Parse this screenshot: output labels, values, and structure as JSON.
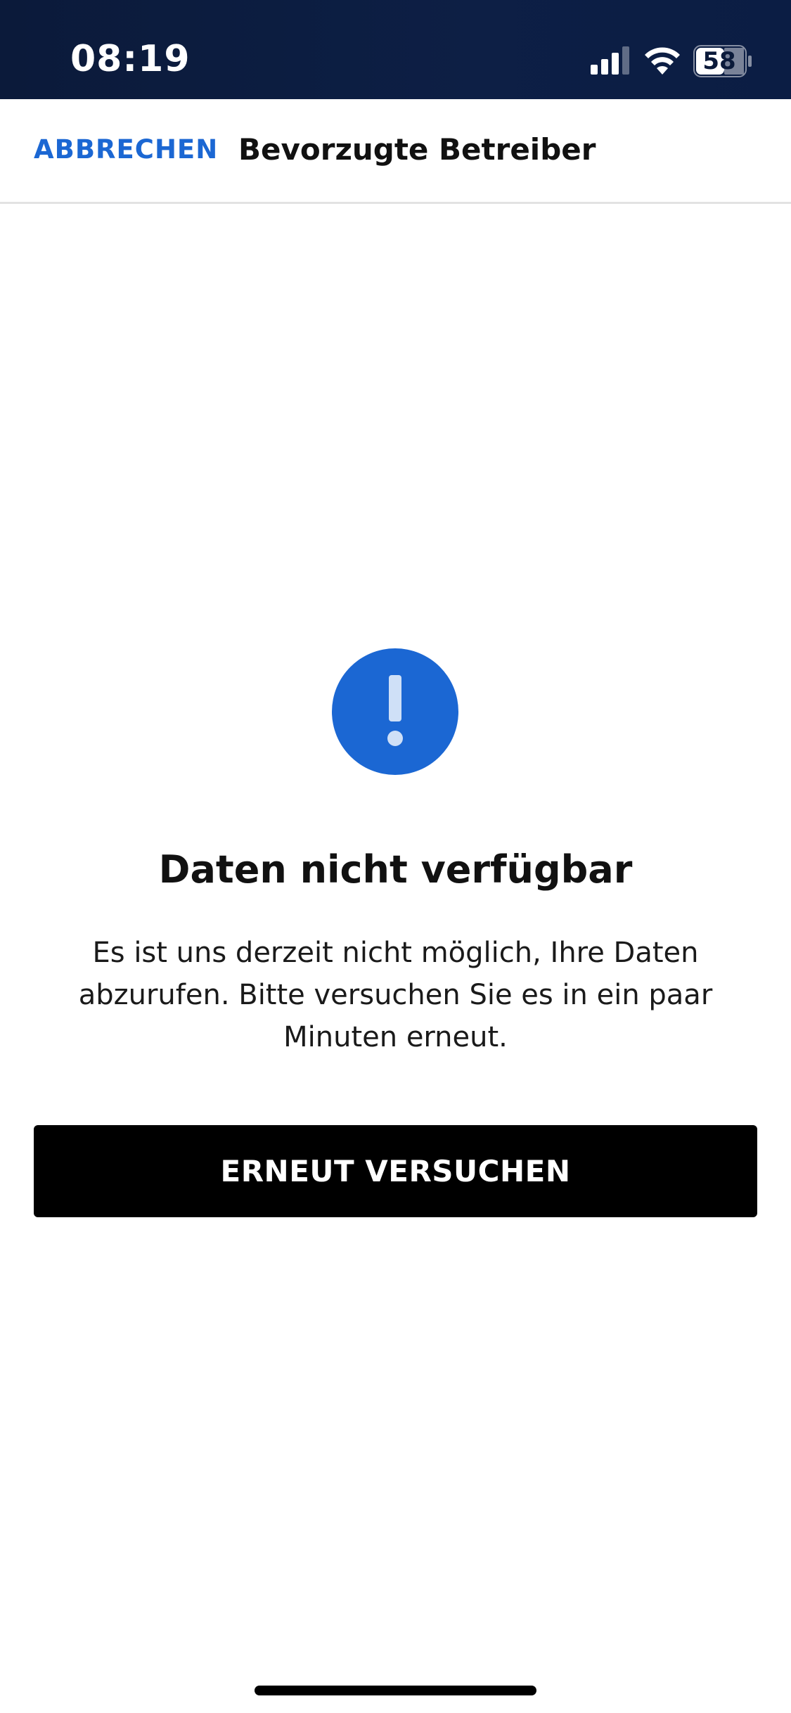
{
  "status_bar": {
    "time": "08:19",
    "battery_level": "58",
    "icons": [
      "signal-icon",
      "wifi-icon",
      "battery-icon"
    ]
  },
  "header": {
    "cancel_label": "ABBRECHEN",
    "title": "Bevorzugte Betreiber"
  },
  "error": {
    "icon": "alert-icon",
    "title": "Daten nicht verfügbar",
    "message": "Es ist uns derzeit nicht möglich, Ihre Daten abzurufen. Bitte versuchen Sie es in ein paar Minuten erneut.",
    "retry_label": "ERNEUT VERSUCHEN"
  },
  "colors": {
    "accent": "#1b67d3",
    "status_bar_bg": "#0b1a3a",
    "button_bg": "#000000"
  }
}
